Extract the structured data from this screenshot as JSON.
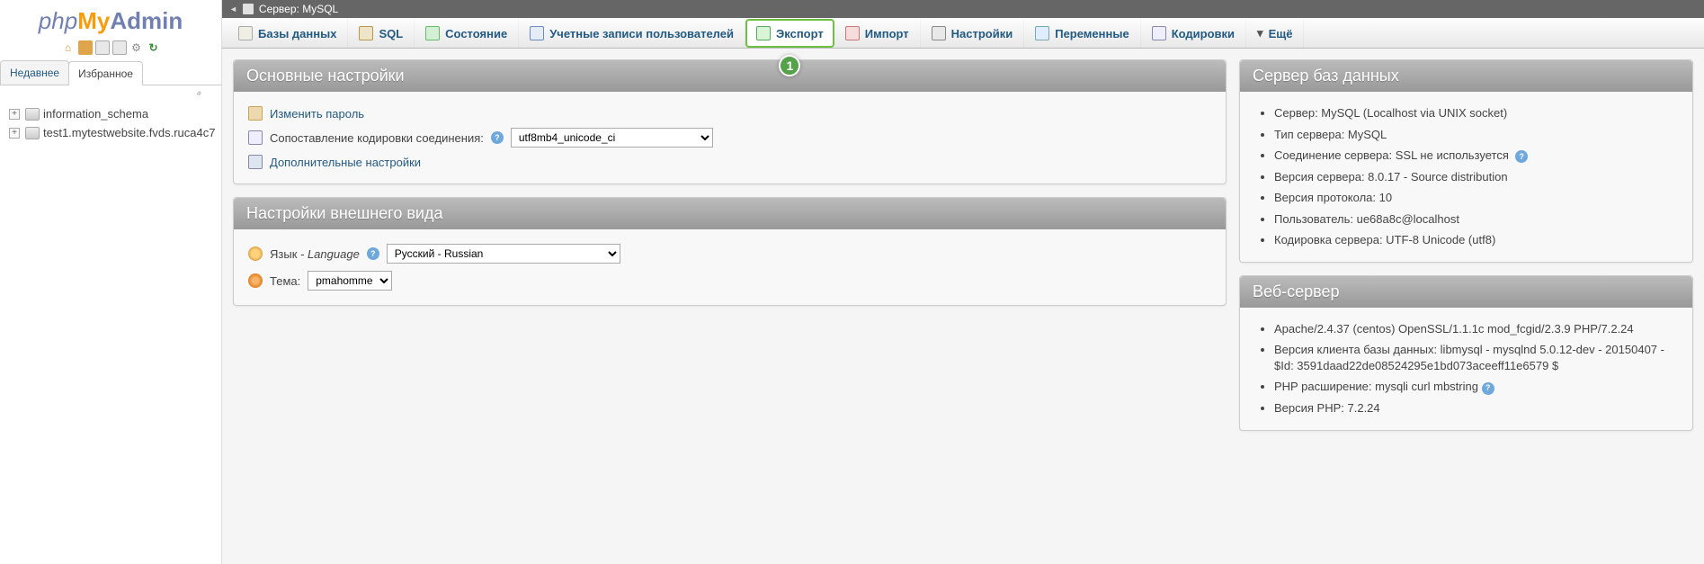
{
  "logo": {
    "php": "php",
    "my": "My",
    "admin": "Admin"
  },
  "sidebar": {
    "tabs": {
      "recent": "Недавнее",
      "favorites": "Избранное"
    },
    "linkchain_title": "",
    "tree": [
      {
        "name": "information_schema"
      },
      {
        "name": "test1.mytestwebsite.fvds.ruca4c7"
      }
    ]
  },
  "header": {
    "arrow": "←",
    "server_label": "Сервер: MySQL"
  },
  "topmenu": {
    "databases": "Базы данных",
    "sql": "SQL",
    "status": "Состояние",
    "users": "Учетные записи пользователей",
    "export": "Экспорт",
    "import": "Импорт",
    "settings": "Настройки",
    "variables": "Переменные",
    "charsets": "Кодировки",
    "more": "Ещё"
  },
  "callout_export": "1",
  "general_settings": {
    "title": "Основные настройки",
    "change_password": "Изменить пароль",
    "collation_label": "Сопоставление кодировки соединения:",
    "collation_value": "utf8mb4_unicode_ci",
    "more_settings": "Дополнительные настройки"
  },
  "appearance": {
    "title": "Настройки внешнего вида",
    "lang_label": "Язык",
    "lang_label2": "- Language",
    "lang_value": "Русский - Russian",
    "theme_label": "Тема:",
    "theme_value": "pmahomme"
  },
  "db_server": {
    "title": "Сервер баз данных",
    "items": [
      "Сервер: MySQL (Localhost via UNIX socket)",
      "Тип сервера: MySQL",
      "Соединение сервера: SSL не используется",
      "Версия сервера: 8.0.17 - Source distribution",
      "Версия протокола: 10",
      "Пользователь: ue68a8c@localhost",
      "Кодировка сервера: UTF-8 Unicode (utf8)"
    ],
    "ssl_help_index": 2
  },
  "web_server": {
    "title": "Веб-сервер",
    "items": [
      "Apache/2.4.37 (centos) OpenSSL/1.1.1c mod_fcgid/2.3.9 PHP/7.2.24",
      "Версия клиента базы данных: libmysql - mysqlnd 5.0.12-dev - 20150407 - $Id: 3591daad22de08524295e1bd073aceeff11e6579 $",
      "PHP расширение: mysqli  curl  mbstring",
      "Версия PHP: 7.2.24"
    ]
  }
}
